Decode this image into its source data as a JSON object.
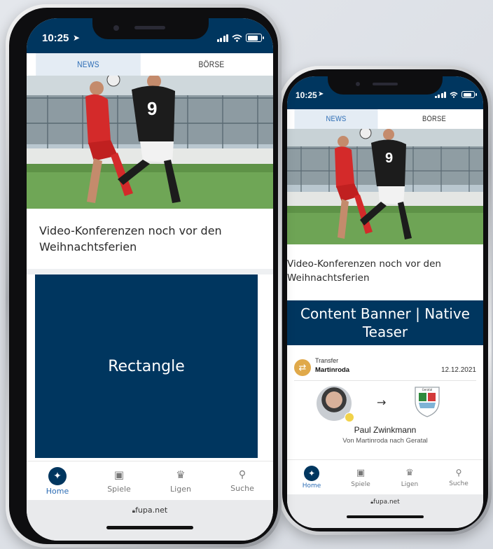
{
  "phone_left": {
    "status": {
      "time": "10:25"
    },
    "tabs": [
      {
        "label": "NEWS",
        "active": true
      },
      {
        "label": "BÖRSE",
        "active": false
      }
    ],
    "headline": "Video-Konferenzen noch vor den Weihnachtsferien",
    "banner": "Rectangle",
    "nav": [
      {
        "label": "Home",
        "icon": "player-icon",
        "active": true
      },
      {
        "label": "Spiele",
        "icon": "calendar-icon",
        "active": false
      },
      {
        "label": "Ligen",
        "icon": "trophy-icon",
        "active": false
      },
      {
        "label": "Suche",
        "icon": "search-icon",
        "active": false
      }
    ],
    "url": "fupa.net"
  },
  "phone_right": {
    "status": {
      "time": "10:25"
    },
    "tabs": [
      {
        "label": "NEWS",
        "active": true
      },
      {
        "label": "BÖRSE",
        "active": false
      }
    ],
    "headline": "Video-Konferenzen noch vor den Weihnachtsferien",
    "banner": "Content Banner | Native Teaser",
    "transfer": {
      "type": "Transfer",
      "club": "Martinroda",
      "date": "12.12.2021",
      "arrow": "→",
      "player": "Paul Zwinkmann",
      "detail": "Von Martinroda nach Geratal"
    },
    "nav": [
      {
        "label": "Home",
        "icon": "player-icon",
        "active": true
      },
      {
        "label": "Spiele",
        "icon": "calendar-icon",
        "active": false
      },
      {
        "label": "Ligen",
        "icon": "trophy-icon",
        "active": false
      },
      {
        "label": "Suche",
        "icon": "search-icon",
        "active": false
      }
    ],
    "url": "fupa.net"
  },
  "colors": {
    "brand": "#00365f",
    "accent": "#2b6cb5",
    "badge": "#e0a94a"
  }
}
